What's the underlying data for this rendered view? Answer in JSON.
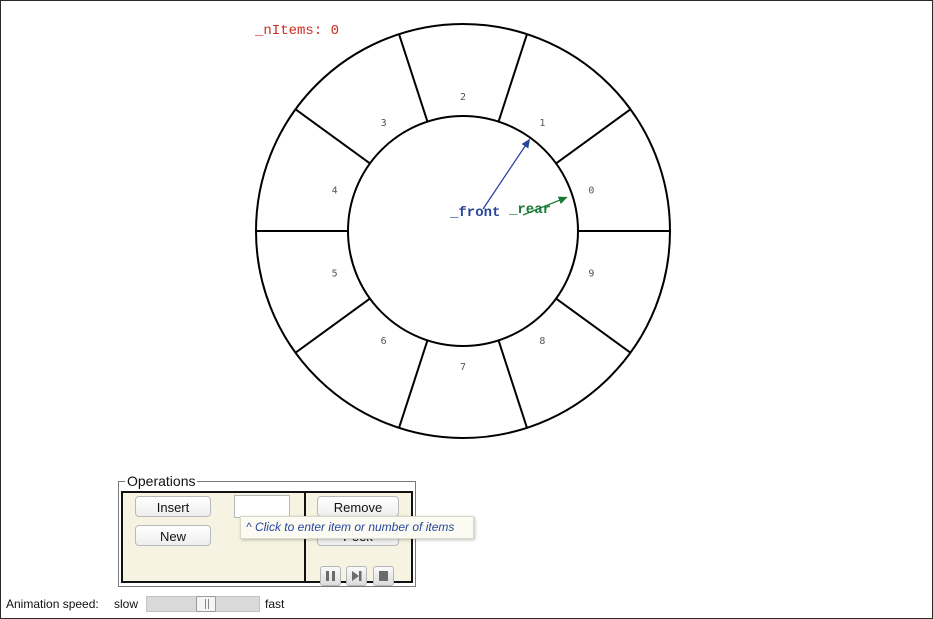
{
  "queue": {
    "n_items_label": "_nItems: 0",
    "front_label": "_front",
    "rear_label": "_rear",
    "cell_indices": [
      "0",
      "1",
      "2",
      "3",
      "4",
      "5",
      "6",
      "7",
      "8",
      "9"
    ],
    "colors": {
      "n_items": "#d02a20",
      "front": "#27469a",
      "rear": "#1a7a35",
      "index": "#555555"
    }
  },
  "operations": {
    "legend": "Operations",
    "insert_label": "Insert",
    "new_label": "New",
    "remove_label": "Remove",
    "peek_label": "Peek",
    "input_value": "",
    "input_placeholder": "",
    "tooltip": "^ Click to enter item or number of items",
    "controls": [
      "pause-icon",
      "step-icon",
      "stop-icon"
    ]
  },
  "animation": {
    "label": "Animation speed:",
    "slow_label": "slow",
    "fast_label": "fast",
    "speed_fraction": 0.52
  }
}
